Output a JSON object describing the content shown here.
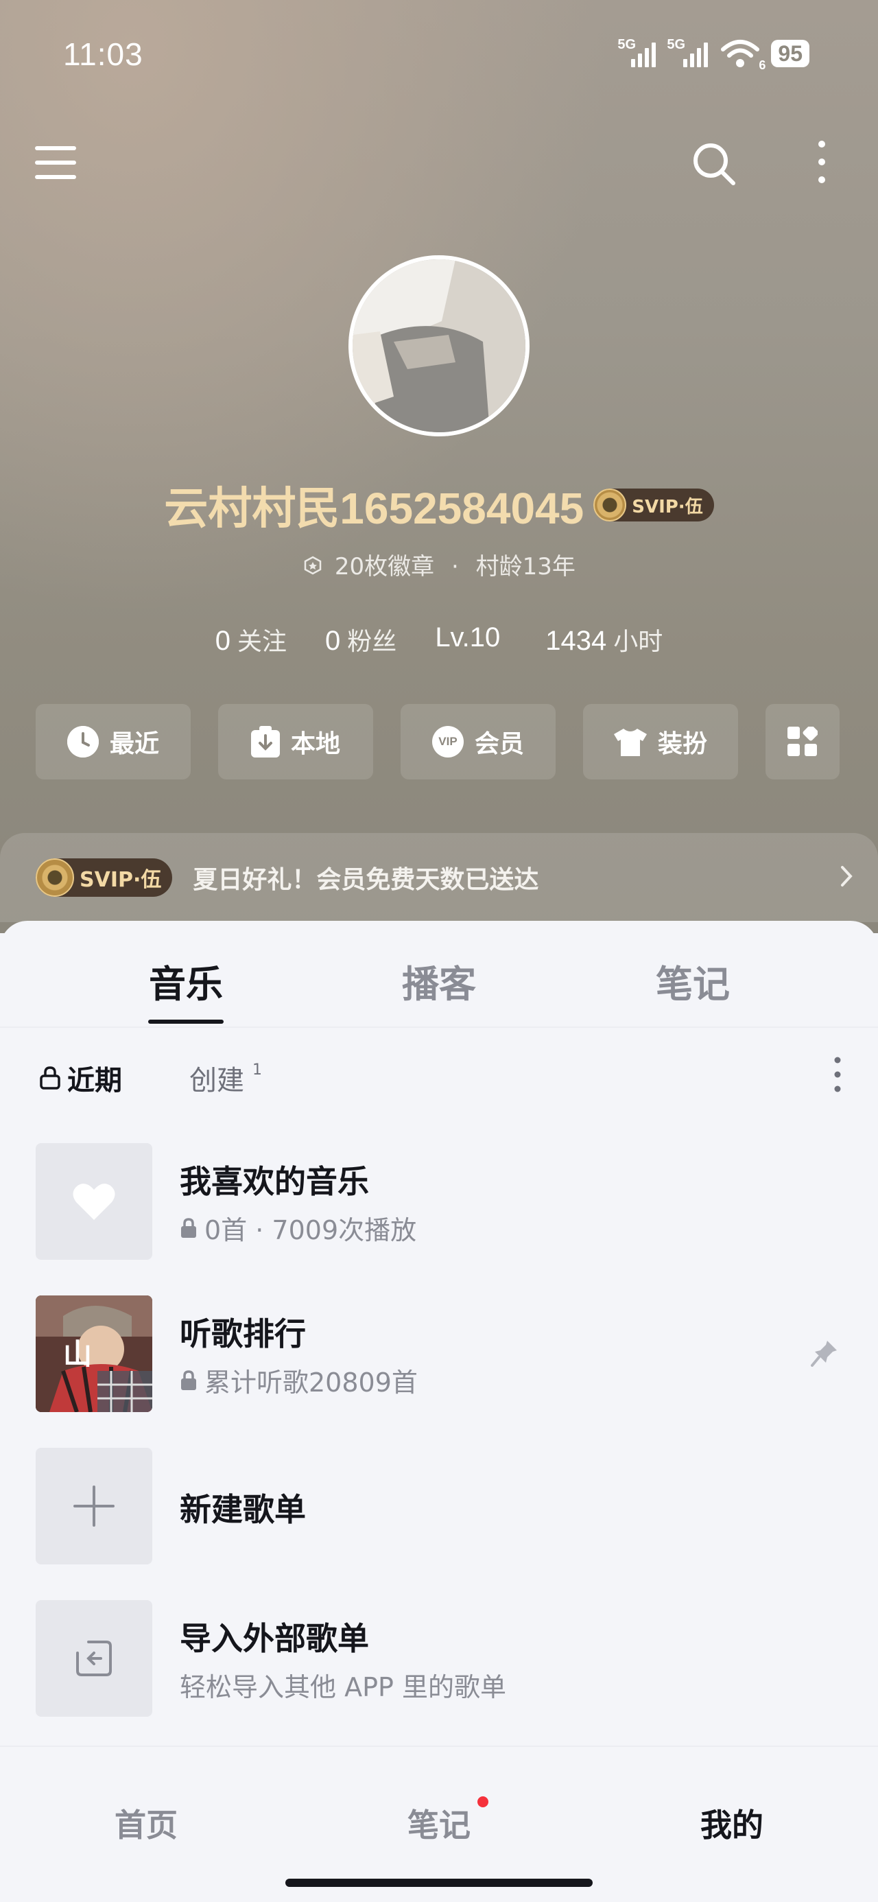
{
  "status_bar": {
    "time": "11:03",
    "signal1_label": "5G",
    "signal2_label": "5G",
    "wifi_label": "6",
    "battery": "95"
  },
  "profile": {
    "username": "云村村民1652584045",
    "svip_label": "SVIP·伍",
    "badges": "20枚徽章",
    "separator": "·",
    "village_age": "村龄13年",
    "following_count": "0",
    "following_label": "关注",
    "fans_count": "0",
    "fans_label": "粉丝",
    "level": "Lv.10",
    "hours_count": "1434",
    "hours_label": "小时"
  },
  "quick_actions": [
    {
      "label": "最近",
      "icon": "clock-icon"
    },
    {
      "label": "本地",
      "icon": "download-icon"
    },
    {
      "label": "会员",
      "icon": "vip-icon",
      "glyph": "VIP"
    },
    {
      "label": "装扮",
      "icon": "tshirt-icon"
    },
    {
      "label": "",
      "icon": "apps-icon"
    }
  ],
  "promo": {
    "svip_label": "SVIP·伍",
    "text": "夏日好礼！会员免费天数已送达"
  },
  "tabs": [
    "音乐",
    "播客",
    "笔记"
  ],
  "subtabs": {
    "recent": "近期",
    "created": "创建",
    "created_count": "1"
  },
  "playlists": [
    {
      "title": "我喜欢的音乐",
      "subtitle": "0首 · 7009次播放",
      "locked": true
    },
    {
      "title": "听歌排行",
      "subtitle": "累计听歌20809首",
      "locked": true
    },
    {
      "title": "新建歌单",
      "subtitle": ""
    },
    {
      "title": "导入外部歌单",
      "subtitle": "轻松导入其他 APP 里的歌单"
    }
  ],
  "bottom_nav": [
    "首页",
    "笔记",
    "我的"
  ],
  "colors": {
    "username": "#f3dcae",
    "badge_bg": "#4a3a2e",
    "notification_dot": "#f5313c",
    "text_primary": "#15161c",
    "text_secondary": "#8a8c95"
  }
}
